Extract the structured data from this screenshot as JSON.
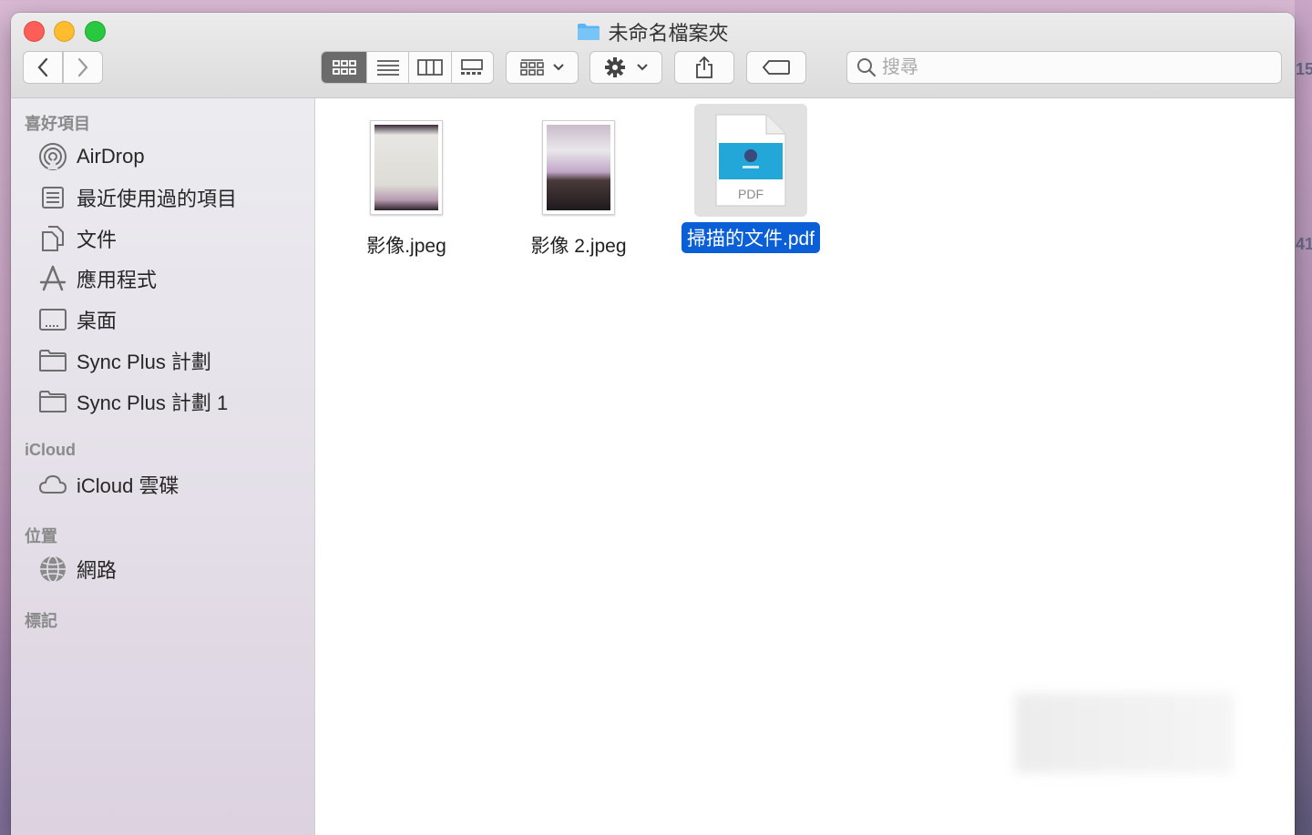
{
  "window": {
    "title": "未命名檔案夾"
  },
  "toolbar": {
    "back_icon": "chevron-left-icon",
    "forward_icon": "chevron-right-icon",
    "view_modes": [
      "icon-view",
      "list-view",
      "column-view",
      "gallery-view"
    ],
    "active_view": "icon-view",
    "group_icon": "group-grid-icon",
    "action_icon": "gear-icon",
    "share_icon": "share-icon",
    "tag_icon": "tag-icon",
    "search_placeholder": "搜尋"
  },
  "sidebar": {
    "favorites_header": "喜好項目",
    "favorites": [
      {
        "label": "AirDrop",
        "icon": "airdrop-icon"
      },
      {
        "label": "最近使用過的項目",
        "icon": "recents-icon"
      },
      {
        "label": "文件",
        "icon": "documents-icon"
      },
      {
        "label": "應用程式",
        "icon": "applications-icon"
      },
      {
        "label": "桌面",
        "icon": "desktop-icon"
      },
      {
        "label": "Sync Plus 計劃",
        "icon": "folder-icon"
      },
      {
        "label": "Sync Plus 計劃 1",
        "icon": "folder-icon"
      }
    ],
    "icloud_header": "iCloud",
    "icloud": [
      {
        "label": "iCloud 雲碟",
        "icon": "cloud-icon"
      }
    ],
    "locations_header": "位置",
    "locations": [
      {
        "label": "網路",
        "icon": "network-icon"
      }
    ],
    "tags_header": "標記"
  },
  "files": [
    {
      "name": "影像.jpeg",
      "kind": "jpeg",
      "selected": false
    },
    {
      "name": "影像 2.jpeg",
      "kind": "jpeg",
      "selected": false
    },
    {
      "name": "掃描的文件.pdf",
      "kind": "pdf",
      "badge": "PDF",
      "selected": true
    }
  ],
  "desktop_edge_text": [
    "15",
    "41"
  ],
  "colors": {
    "selection": "#0a5fd6",
    "close": "#fd5e57",
    "minimize": "#febc2e",
    "zoom": "#28c840",
    "folder": "#5ab4f5"
  }
}
